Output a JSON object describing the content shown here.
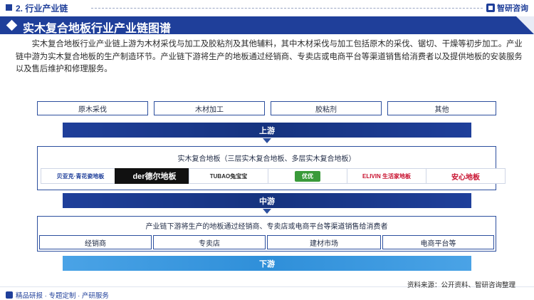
{
  "header": {
    "section": "2. 行业产业链",
    "brand": "智研咨询"
  },
  "title": "实木复合地板行业产业链图谱",
  "paragraph": "实木复合地板行业产业链上游为木材采伐与加工及胶粘剂及其他辅料，其中木材采伐与加工包括原木的采伐、锯切、干燥等初步加工。产业链中游为实木复合地板的生产制造环节。产业链下游将生产的地板通过经销商、专卖店或电商平台等渠道销售给消费者以及提供地板的安装服务以及售后维护和修理服务。",
  "upstream": {
    "items": [
      "原木采伐",
      "木材加工",
      "胶粘剂",
      "其他"
    ],
    "label": "上游"
  },
  "midstream": {
    "frame_title": "实木复合地板（三层实木复合地板、多层实木复合地板）",
    "logos": [
      {
        "text": "贝亚克·青花瓷地板",
        "color": "#1f3f9a"
      },
      {
        "text": "der德尔地板",
        "color": "#ffffff"
      },
      {
        "text": "TUBAO兔宝宝",
        "color": "#2a2a2a"
      },
      {
        "text": "优优",
        "color": "#ffffff"
      },
      {
        "text": "ELIVIN 生活家地板",
        "color": "#c8102e"
      },
      {
        "text": "安心地板",
        "color": "#c8102e"
      }
    ],
    "label": "中游"
  },
  "downstream": {
    "frame_title": "产业链下游将生产的地板通过经销商、专卖店或电商平台等渠道销售给消费者",
    "items": [
      "经销商",
      "专卖店",
      "建材市场",
      "电商平台等"
    ],
    "label": "下游"
  },
  "footer": {
    "left": "精品研报 · 专题定制 · 产研服务",
    "source": "资料来源：公开资料、智研咨询整理"
  },
  "colors": {
    "primary": "#1f3f9a",
    "light_band": "#2f8fd9",
    "border": "#2c4f9e"
  }
}
